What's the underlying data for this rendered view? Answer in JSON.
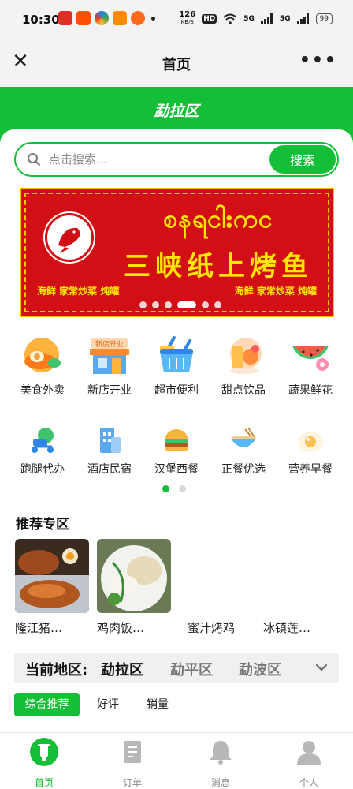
{
  "status_bar": {
    "time": "10:30",
    "speed_value": "126",
    "speed_unit": "KB/S",
    "hd": "HD",
    "net1": "5G",
    "net2": "5G",
    "battery": "99"
  },
  "nav": {
    "title": "首页"
  },
  "region_header": {
    "title": "勐拉区"
  },
  "search": {
    "placeholder": "点击搜索...",
    "button": "搜索"
  },
  "banner": {
    "burmese_text": "စနရငါးကင",
    "chinese_text": "三峡纸上烤鱼",
    "tag_left": "海鲜  家常炒菜  炖罐",
    "tag_right": "海鲜  家常炒菜  炖罐",
    "slide_count": 6,
    "active_slide": 3
  },
  "categories": [
    {
      "label": "美食外卖",
      "icon": "food-delivery-icon"
    },
    {
      "label": "新店开业",
      "icon": "new-store-icon",
      "badge": "新店开业"
    },
    {
      "label": "超市便利",
      "icon": "shopping-basket-icon"
    },
    {
      "label": "甜点饮品",
      "icon": "dessert-drink-icon"
    },
    {
      "label": "蔬果鲜花",
      "icon": "fruit-flower-icon"
    },
    {
      "label": "跑腿代办",
      "icon": "errand-scooter-icon"
    },
    {
      "label": "酒店民宿",
      "icon": "hotel-building-icon"
    },
    {
      "label": "汉堡西餐",
      "icon": "burger-icon"
    },
    {
      "label": "正餐优选",
      "icon": "meal-bowl-icon"
    },
    {
      "label": "营养早餐",
      "icon": "breakfast-egg-icon"
    }
  ],
  "category_pages": {
    "count": 2,
    "active": 1
  },
  "recommend": {
    "title": "推荐专区",
    "items": [
      {
        "name": "隆江猪…"
      },
      {
        "name": "鸡肉饭…"
      },
      {
        "name": "蜜汁烤鸡"
      },
      {
        "name": "冰镇莲…"
      }
    ]
  },
  "region_tabs": {
    "label": "当前地区:",
    "tabs": [
      "勐拉区",
      "勐平区",
      "勐波区"
    ],
    "active": 0
  },
  "sort_chips": [
    "综合推荐",
    "好评",
    "销量"
  ],
  "tabbar": [
    {
      "label": "首页",
      "active": true
    },
    {
      "label": "订单",
      "active": false
    },
    {
      "label": "消息",
      "active": false
    },
    {
      "label": "个人",
      "active": false
    }
  ],
  "colors": {
    "brand_green": "#14be36",
    "banner_red": "#d10f14",
    "banner_yellow": "#ffe600"
  }
}
